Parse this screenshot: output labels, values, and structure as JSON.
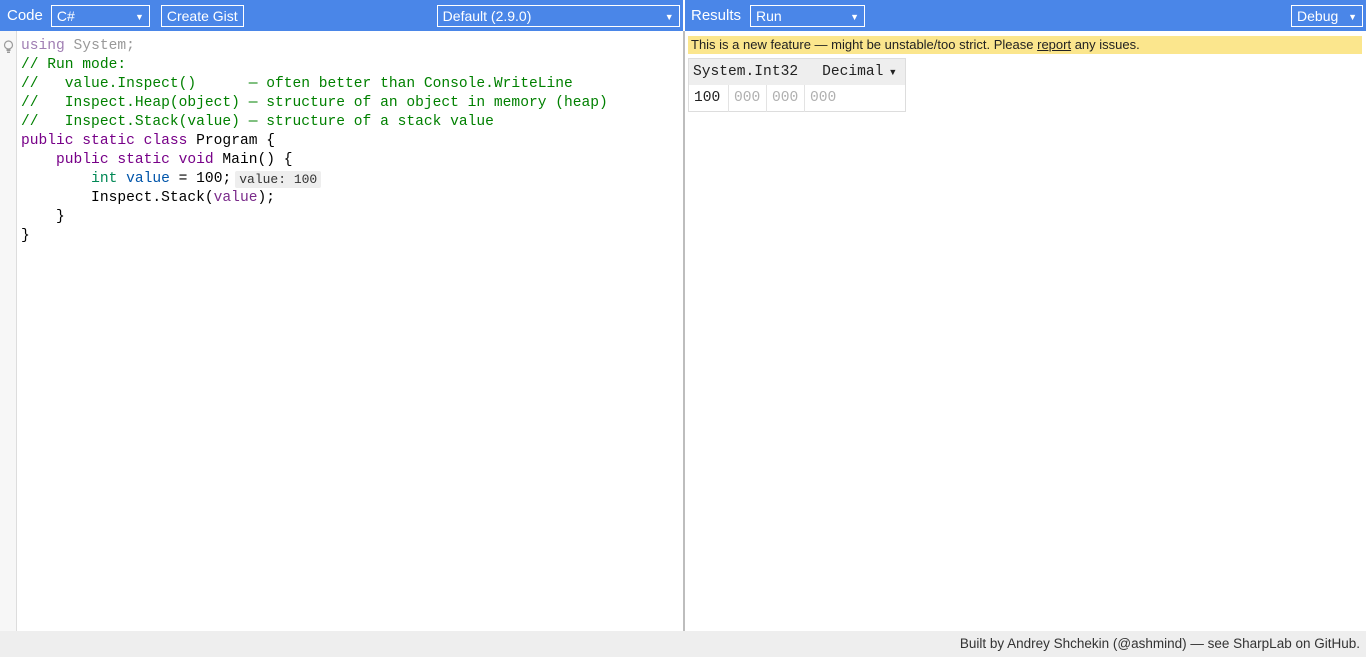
{
  "code_toolbar": {
    "label": "Code",
    "language": "C#",
    "create_gist": "Create Gist",
    "branch": "Default (2.9.0)"
  },
  "results_toolbar": {
    "label": "Results",
    "mode": "Run",
    "configuration": "Debug"
  },
  "editor": {
    "lines": [
      {
        "parts": [
          {
            "t": "using",
            "c": "kw-dim"
          },
          {
            "t": " System;",
            "c": "dim"
          }
        ]
      },
      {
        "parts": [
          {
            "t": "// Run mode:",
            "c": "comment"
          }
        ]
      },
      {
        "parts": [
          {
            "t": "//   value.Inspect()      — often better than Console.WriteLine",
            "c": "comment"
          }
        ]
      },
      {
        "parts": [
          {
            "t": "//   Inspect.Heap(object) — structure of an object in memory (heap)",
            "c": "comment"
          }
        ]
      },
      {
        "parts": [
          {
            "t": "//   Inspect.Stack(value) — structure of a stack value",
            "c": "comment"
          }
        ]
      },
      {
        "parts": [
          {
            "t": "public static class",
            "c": "kw"
          },
          {
            "t": " Program {",
            "c": ""
          }
        ]
      },
      {
        "parts": [
          {
            "t": "    ",
            "c": ""
          },
          {
            "t": "public static void",
            "c": "kw"
          },
          {
            "t": " Main() {",
            "c": ""
          }
        ]
      },
      {
        "parts": [
          {
            "t": "        ",
            "c": ""
          },
          {
            "t": "int",
            "c": "type"
          },
          {
            "t": " ",
            "c": ""
          },
          {
            "t": "value",
            "c": "var"
          },
          {
            "t": " = 100;",
            "c": ""
          }
        ],
        "hint": "value: 100"
      },
      {
        "parts": [
          {
            "t": "        Inspect.Stack(",
            "c": ""
          },
          {
            "t": "value",
            "c": "varref"
          },
          {
            "t": ");",
            "c": ""
          }
        ]
      },
      {
        "parts": [
          {
            "t": "    }",
            "c": ""
          }
        ]
      },
      {
        "parts": [
          {
            "t": "}",
            "c": ""
          }
        ]
      }
    ]
  },
  "results": {
    "warning_prefix": "This is a new feature — might be unstable/too strict. Please ",
    "warning_link": "report",
    "warning_suffix": " any issues.",
    "inspect": {
      "type_name": "System.Int32",
      "display_mode": "Decimal",
      "bytes": [
        "100",
        "000",
        "000",
        "000"
      ]
    }
  },
  "footer": {
    "text": "Built by Andrey Shchekin (@ashmind) — see SharpLab on GitHub."
  }
}
